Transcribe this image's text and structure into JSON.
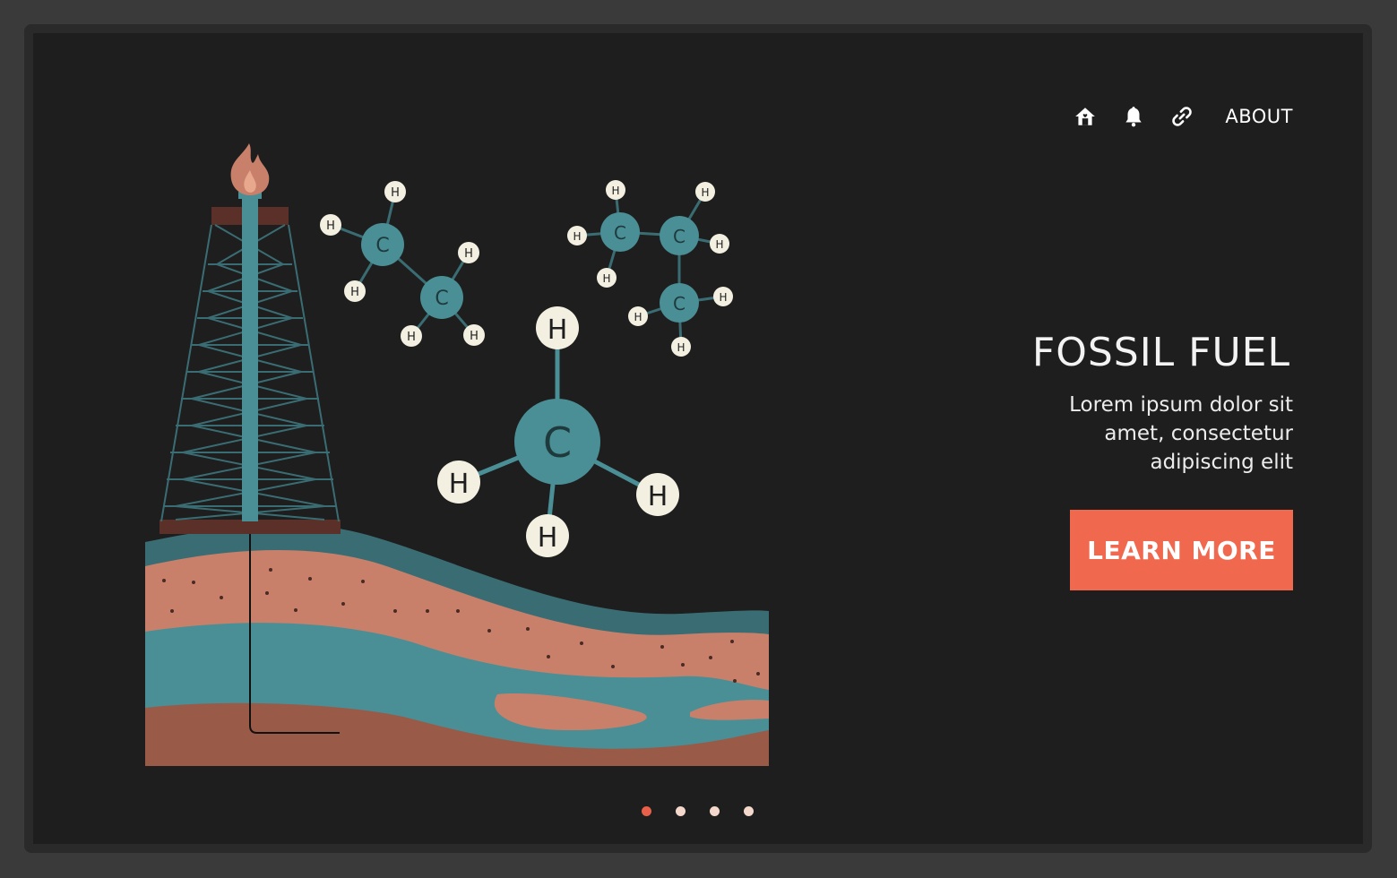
{
  "nav": {
    "items": [
      {
        "icon": "home-icon"
      },
      {
        "icon": "bell-icon"
      },
      {
        "icon": "link-icon"
      }
    ],
    "about_label": "ABOUT"
  },
  "hero": {
    "title": "FOSSIL FUEL",
    "text": "Lorem ipsum dolor sit amet, consectetur adipiscing elit",
    "cta_label": "LEARN MORE"
  },
  "illustration": {
    "atom_labels": {
      "carbon": "C",
      "hydrogen": "H"
    }
  },
  "pagination": {
    "count": 4,
    "active_index": 0
  },
  "colors": {
    "background": "#1e1e1e",
    "frame": "#2a2a2a",
    "teal": "#4a8f96",
    "dark_teal": "#3a6d73",
    "rock_pink": "#c9806a",
    "rock_brown": "#9a5a48",
    "accent": "#f0684d",
    "atom_cream": "#f3f0e2"
  }
}
